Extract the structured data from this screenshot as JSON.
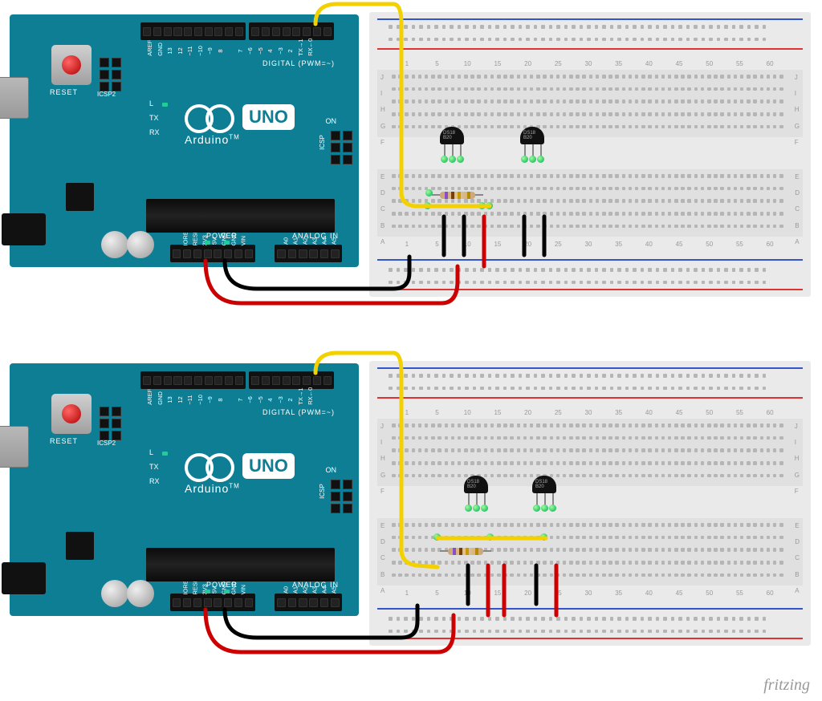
{
  "credit": "fritzing",
  "arduino": {
    "reset": "RESET",
    "icsp2": "ICSP2",
    "icsp": "ICSP",
    "uno": "UNO",
    "brand": "Arduino",
    "tm": "TM",
    "digital": "DIGITAL (PWM=~)",
    "power": "POWER",
    "analog_in": "ANALOG IN",
    "led_L": "L",
    "led_TX": "TX",
    "led_RX": "RX",
    "on": "ON",
    "top_pins": [
      "AREF",
      "GND",
      "13",
      "12",
      "~11",
      "~10",
      "~9",
      "8",
      "",
      "7",
      "~6",
      "~5",
      "4",
      "~3",
      "2",
      "TX→1",
      "RX←0"
    ],
    "power_pins": [
      "IOREF",
      "RESET",
      "3V3",
      "5V",
      "GND",
      "GND",
      "VIN"
    ],
    "analog_pins": [
      "A0",
      "A1",
      "A2",
      "A3",
      "A4",
      "A5"
    ]
  },
  "breadboard": {
    "cols": [
      "1",
      "5",
      "10",
      "15",
      "20",
      "25",
      "30",
      "35",
      "40",
      "45",
      "50",
      "55",
      "60"
    ],
    "rows_top": [
      "J",
      "I",
      "H",
      "G",
      "F"
    ],
    "rows_bot": [
      "E",
      "D",
      "C",
      "B",
      "A"
    ]
  },
  "sensor": {
    "label": "DS18\\nB20"
  },
  "circuit1": {
    "data_pin": "2",
    "resistor": "4.7k",
    "sensors": 2,
    "topology": "shared-bus"
  },
  "circuit2": {
    "data_pin": "2",
    "resistor": "4.7k",
    "sensors": 2,
    "topology": "separate-power"
  }
}
